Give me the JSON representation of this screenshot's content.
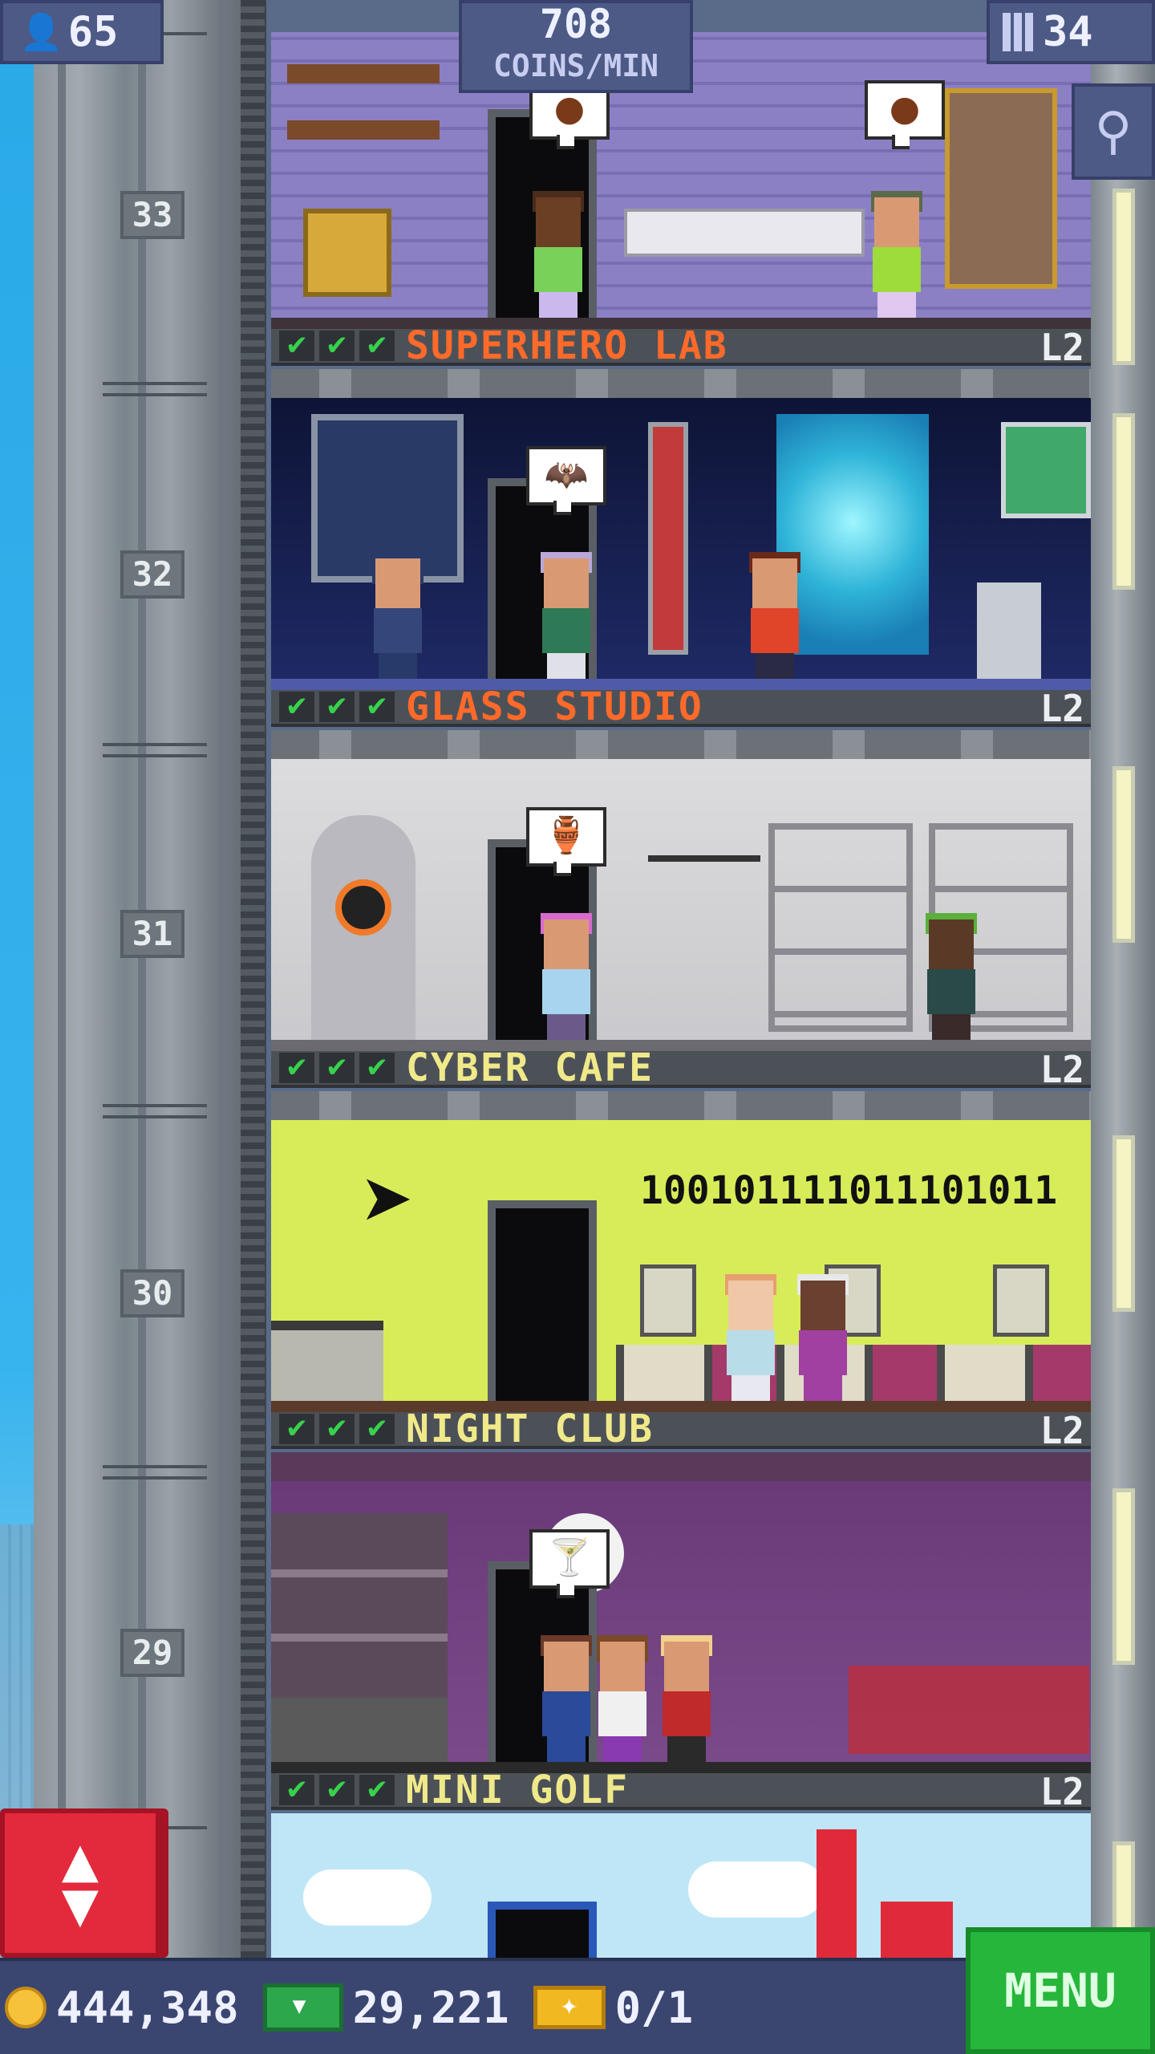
{
  "hud": {
    "population": "65",
    "income_value": "708",
    "income_unit": "COINS/MIN",
    "floor_count": "34",
    "population_icon": "person-icon",
    "floors_icon": "building-icon",
    "search_icon": "magnifier-icon"
  },
  "shaft": {
    "floor_numbers": [
      "33",
      "32",
      "31",
      "30",
      "29"
    ]
  },
  "floors": [
    {
      "name": "SUPERHERO LAB",
      "level": "L2",
      "name_color": "#ff6a2a",
      "checks": [
        "✔",
        "✔",
        "✔"
      ],
      "bubble": "🦇"
    },
    {
      "name": "GLASS STUDIO",
      "level": "L2",
      "name_color": "#ff6a2a",
      "checks": [
        "✔",
        "✔",
        "✔"
      ],
      "bubble": "🏺"
    },
    {
      "name": "CYBER CAFE",
      "level": "L2",
      "name_color": "#f0e98a",
      "checks": [
        "✔",
        "✔",
        "✔"
      ],
      "screen_text": "100101111011101011"
    },
    {
      "name": "NIGHT CLUB",
      "level": "L2",
      "name_color": "#f0e98a",
      "checks": [
        "✔",
        "✔",
        "✔"
      ],
      "bubble": "🍸"
    },
    {
      "name": "MINI GOLF",
      "level": "L2",
      "name_color": "#f0e98a",
      "checks": [
        "✔",
        "✔",
        "✔"
      ]
    }
  ],
  "top_floor": {
    "bubble_left": "●",
    "bubble_right": "●"
  },
  "elevator_button": {
    "up": "▲",
    "down": "▼",
    "icon": "elevator-arrows-icon"
  },
  "bottom": {
    "coins": "444,348",
    "bux": "29,221",
    "tickets": "0/1",
    "menu_label": "MENU",
    "coin_icon": "coin-icon",
    "bux_icon": "bux-icon",
    "ticket_icon": "ticket-icon"
  },
  "colors": {
    "hud_bg": "#4d5a86",
    "check_green": "#38d14b",
    "menu_green": "#26b63b",
    "elevator_red": "#e32a3c"
  }
}
